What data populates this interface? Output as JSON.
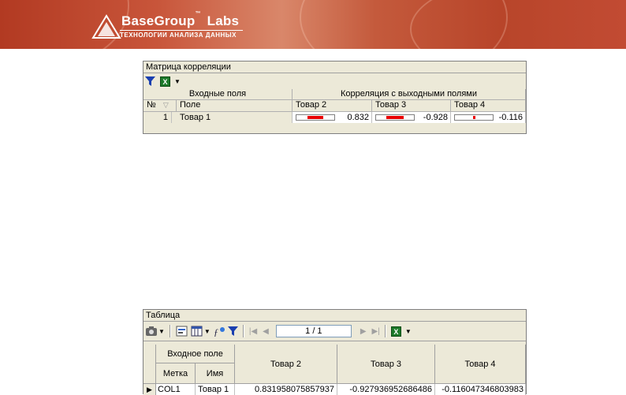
{
  "banner": {
    "brand_name": "BaseGroup",
    "brand_tm": "™",
    "brand_labs": "Labs",
    "brand_tm2": "™",
    "tagline": "ТЕХНОЛОГИИ АНАЛИЗА ДАННЫХ",
    "colors": {
      "background": "#b8452a",
      "text": "#ffffff"
    }
  },
  "correlation_panel": {
    "title": "Матрица корреляции",
    "toolbar": {
      "filter": "filter-icon",
      "export": "excel-export-icon"
    },
    "group_headers": {
      "input": "Входные поля",
      "output": "Корреляция с выходными полями"
    },
    "columns": {
      "num": "№",
      "field": "Поле",
      "outputs": [
        "Товар 2",
        "Товар 3",
        "Товар 4"
      ]
    },
    "rows": [
      {
        "num": "1",
        "field": "Товар 1",
        "values": [
          {
            "text": "0.832",
            "value": 0.832
          },
          {
            "text": "-0.928",
            "value": -0.928
          },
          {
            "text": "-0.116",
            "value": -0.116
          }
        ]
      }
    ],
    "bar_color": "#e80000"
  },
  "table_panel": {
    "title": "Таблица",
    "toolbar": {
      "page_indicator": "1 / 1"
    },
    "group_header": "Входное поле",
    "columns": {
      "label": "Метка",
      "name": "Имя",
      "outputs": [
        "Товар 2",
        "Товар 3",
        "Товар 4"
      ]
    },
    "rows": [
      {
        "label": "COL1",
        "name": "Товар 1",
        "values": [
          "0.831958075857937",
          "-0.927936952686486",
          "-0.116047346803983"
        ]
      }
    ]
  }
}
